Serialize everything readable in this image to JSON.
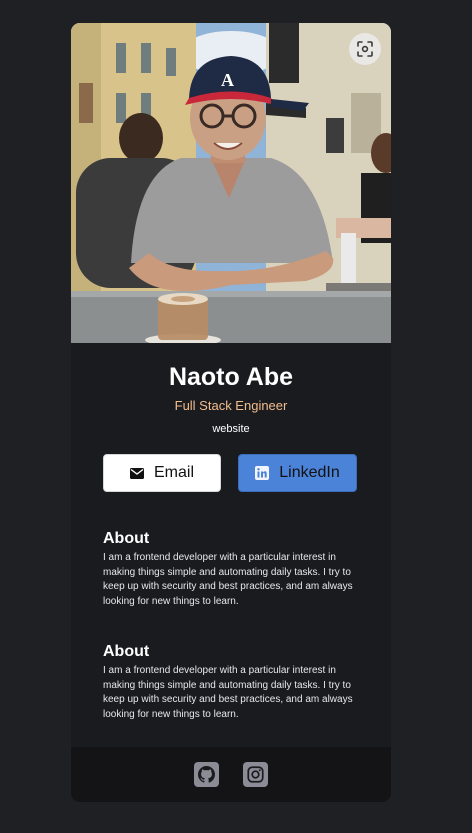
{
  "profile": {
    "name": "Naoto Abe",
    "role": "Full Stack Engineer",
    "website": "website",
    "photo_alt": "Profile photo"
  },
  "actions": {
    "email_label": "Email",
    "linkedin_label": "LinkedIn"
  },
  "sections": [
    {
      "title": "About",
      "body": "I am a frontend developer with a particular interest in making things simple and automating daily tasks. I try to keep up with security and best practices, and am always looking for new things to learn."
    },
    {
      "title": "About",
      "body": "I am a frontend developer with a particular interest in making things simple and automating daily tasks. I try to keep up with security and best practices, and am always looking for new things to learn."
    }
  ],
  "footer": {
    "links": [
      {
        "icon": "github-icon"
      },
      {
        "icon": "instagram-icon"
      }
    ]
  },
  "colors": {
    "background": "#1f2024",
    "card": "#1a1b1f",
    "accent_role": "#f3bc8e",
    "linkedin": "#4b83d9",
    "footer": "#141417"
  }
}
